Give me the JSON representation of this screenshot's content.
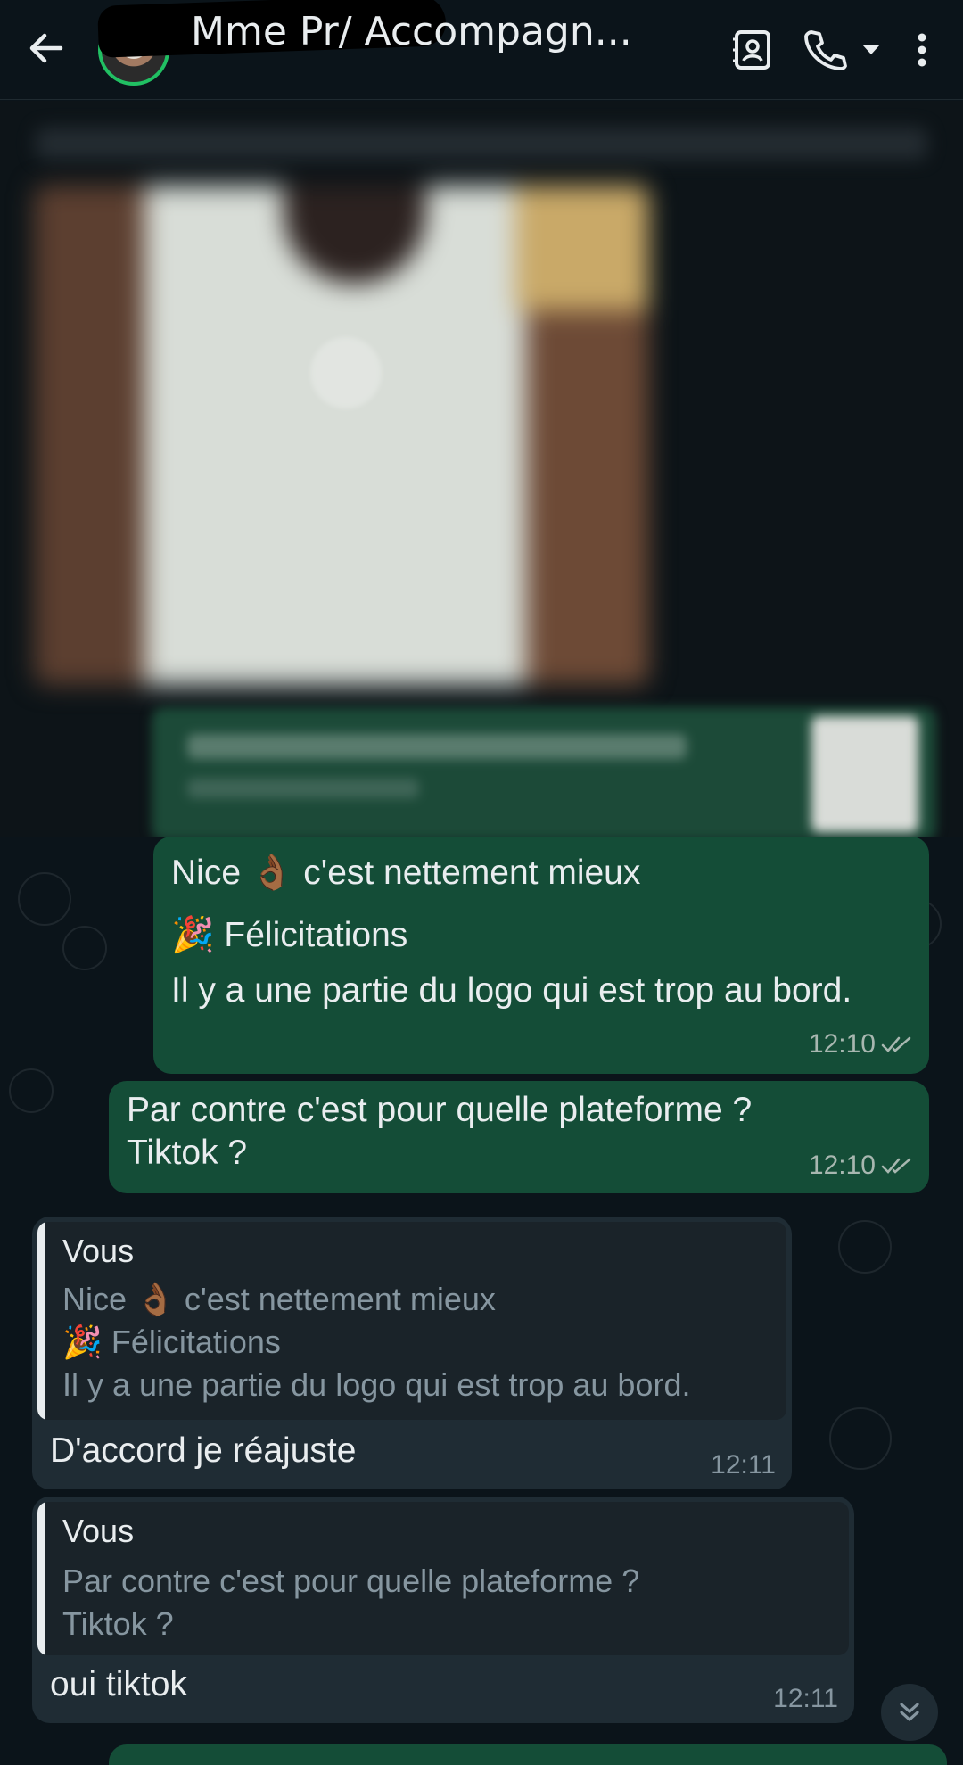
{
  "header": {
    "title": "Mme          Pr/ Accompagn...",
    "back_icon": "arrow-left-icon",
    "avatar_icon": "contact-avatar",
    "icons": [
      "contacts-book-icon",
      "phone-icon",
      "caret-down-icon",
      "more-vert-icon"
    ]
  },
  "messages": [
    {
      "direction": "outgoing",
      "lines": [
        "Nice 👌🏾 c'est nettement mieux",
        "🎉 Félicitations",
        "Il y a une partie du logo qui est trop au bord."
      ],
      "time": "12:10",
      "status": "read"
    },
    {
      "direction": "outgoing",
      "lines": [
        "Par contre c'est pour quelle plateforme ?",
        "Tiktok ?"
      ],
      "time": "12:10",
      "status": "read"
    },
    {
      "direction": "incoming",
      "quote": {
        "author": "Vous",
        "lines": [
          "Nice 👌🏾 c'est nettement mieux",
          "🎉 Félicitations",
          "Il y a une partie du logo qui est trop au bord."
        ]
      },
      "text": "D'accord je réajuste",
      "time": "12:11"
    },
    {
      "direction": "incoming",
      "quote": {
        "author": "Vous",
        "lines": [
          "Par contre c'est pour quelle plateforme ?",
          "Tiktok ?"
        ]
      },
      "text": "oui tiktok",
      "time": "12:11"
    }
  ],
  "scroll_button_icon": "double-chevron-down-icon",
  "colors": {
    "background": "#0b141a",
    "outgoing_bubble": "#144d37",
    "incoming_bubble": "#1f2c34",
    "accent": "#21c063"
  }
}
